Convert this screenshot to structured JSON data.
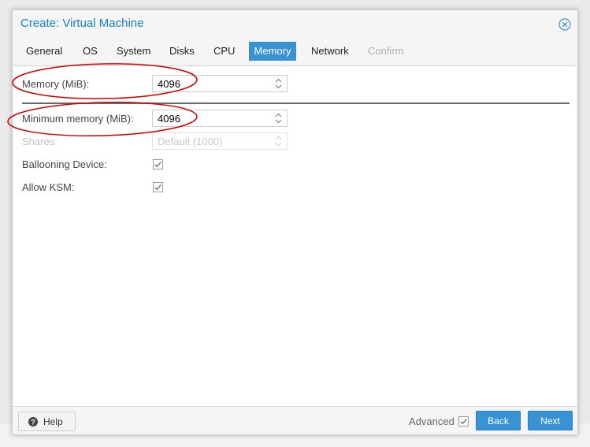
{
  "window": {
    "title": "Create: Virtual Machine"
  },
  "tabs": [
    {
      "label": "General",
      "state": "normal"
    },
    {
      "label": "OS",
      "state": "normal"
    },
    {
      "label": "System",
      "state": "normal"
    },
    {
      "label": "Disks",
      "state": "normal"
    },
    {
      "label": "CPU",
      "state": "normal"
    },
    {
      "label": "Memory",
      "state": "active"
    },
    {
      "label": "Network",
      "state": "normal"
    },
    {
      "label": "Confirm",
      "state": "disabled"
    }
  ],
  "form": {
    "memory": {
      "label": "Memory (MiB):",
      "value": "4096"
    },
    "minimum_memory": {
      "label": "Minimum memory (MiB):",
      "value": "4096"
    },
    "shares": {
      "label": "Shares:",
      "value": "Default (1000)",
      "disabled": true
    },
    "ballooning": {
      "label": "Ballooning Device:",
      "checked": true
    },
    "ksm": {
      "label": "Allow KSM:",
      "checked": true
    }
  },
  "footer": {
    "help_label": "Help",
    "advanced_label": "Advanced",
    "advanced_checked": true,
    "back_label": "Back",
    "next_label": "Next"
  },
  "colors": {
    "accent": "#3892d4",
    "title": "#157fcc",
    "annotation": "#d40000"
  },
  "icons": {
    "close": "close-circle-icon",
    "help": "question-circle-icon",
    "spinner": "up-down-chevron-icon",
    "checkbox": "checkmark-icon"
  }
}
